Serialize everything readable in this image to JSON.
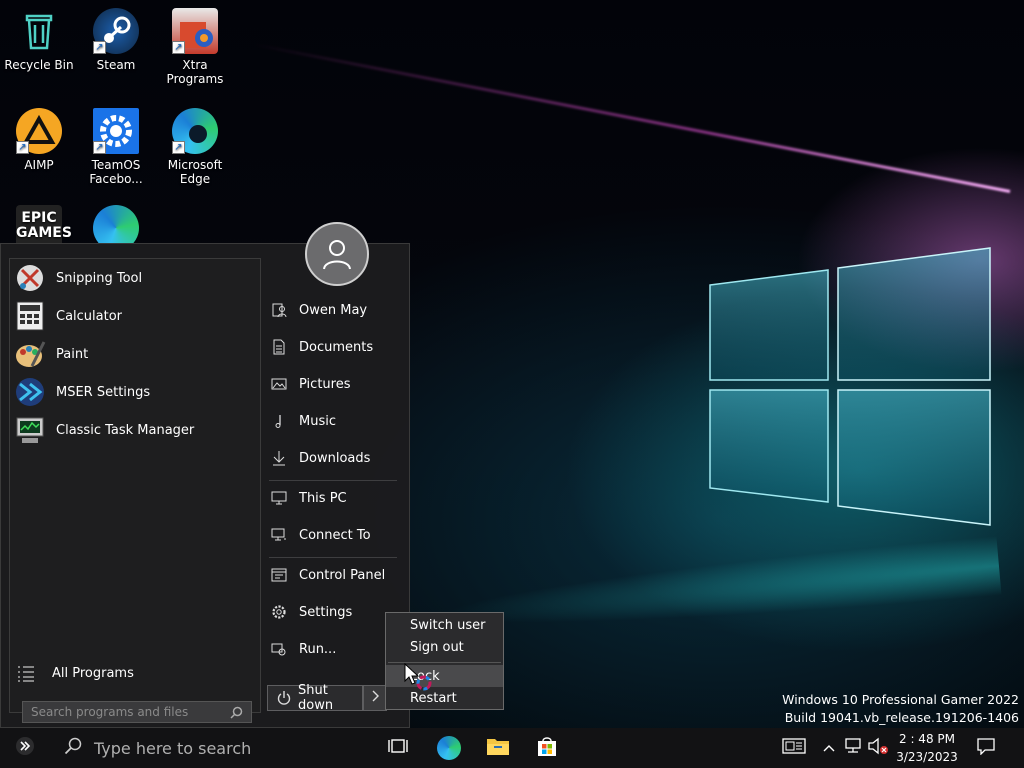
{
  "desktop": {
    "icons": [
      {
        "label": "Recycle Bin",
        "icon": "recycle-bin-icon"
      },
      {
        "label": "Steam",
        "icon": "steam-icon"
      },
      {
        "label": "Xtra Programs",
        "icon": "xtra-programs-icon"
      },
      {
        "label": "AIMP",
        "icon": "aimp-icon"
      },
      {
        "label": "TeamOS Facebo...",
        "icon": "teamos-gear-icon"
      },
      {
        "label": "Microsoft Edge",
        "icon": "edge-icon"
      },
      {
        "label": "EPIC GAMES",
        "icon": "epic-games-icon"
      },
      {
        "label": "",
        "icon": "edge-icon"
      }
    ]
  },
  "start_menu": {
    "programs": [
      {
        "label": "Snipping Tool",
        "icon": "snipping-tool-icon"
      },
      {
        "label": "Calculator",
        "icon": "calculator-icon"
      },
      {
        "label": "Paint",
        "icon": "paint-icon"
      },
      {
        "label": "MSER Settings",
        "icon": "mser-settings-icon"
      },
      {
        "label": "Classic Task Manager",
        "icon": "task-manager-icon"
      }
    ],
    "all_programs": "All Programs",
    "search_placeholder": "Search programs and files",
    "right_items": [
      {
        "label": "Owen May",
        "icon": "user-folder-icon"
      },
      {
        "label": "Documents",
        "icon": "document-icon"
      },
      {
        "label": "Pictures",
        "icon": "picture-icon"
      },
      {
        "label": "Music",
        "icon": "music-icon"
      },
      {
        "label": "Downloads",
        "icon": "download-icon"
      },
      {
        "label": "This PC",
        "icon": "computer-icon"
      },
      {
        "label": "Connect To",
        "icon": "network-icon"
      },
      {
        "label": "Control Panel",
        "icon": "control-panel-icon"
      },
      {
        "label": "Settings",
        "icon": "gear-icon"
      },
      {
        "label": "Run...",
        "icon": "run-icon"
      }
    ],
    "shutdown_label": "Shut down"
  },
  "power_popup": {
    "items": [
      "Switch user",
      "Sign out",
      "Lock",
      "Restart"
    ]
  },
  "watermark": {
    "line1": "Windows 10 Professional Gamer 2022",
    "line2": "Build 19041.vb_release.191206-1406"
  },
  "taskbar": {
    "search_placeholder": "Type here to search",
    "time": "2 : 48 PM",
    "date": "3/23/2023"
  },
  "colors": {
    "menu_bg": "#1c1c1e",
    "taskbar_bg": "#121214",
    "accent": "#0a84d0"
  }
}
